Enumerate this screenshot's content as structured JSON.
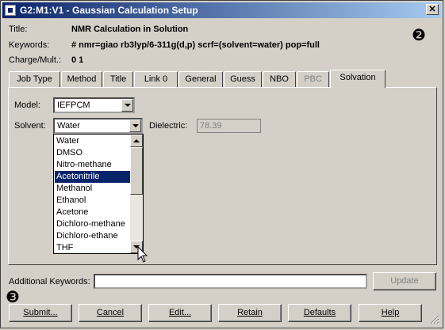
{
  "window": {
    "title": "G2:M1:V1 - Gaussian Calculation Setup",
    "close_glyph": "✕"
  },
  "header": {
    "title_label": "Title:",
    "title_value": "NMR Calculation in Solution",
    "keywords_label": "Keywords:",
    "keywords_value": "# nmr=giao rb3lyp/6-311g(d,p) scrf=(solvent=water) pop=full",
    "charge_label": "Charge/Mult.:",
    "charge_value": "0 1"
  },
  "badges": {
    "two": "❷",
    "three": "❸"
  },
  "tabs": [
    {
      "label": "Job Type",
      "state": "normal"
    },
    {
      "label": "Method",
      "state": "normal"
    },
    {
      "label": "Title",
      "state": "normal"
    },
    {
      "label": "Link 0",
      "state": "normal"
    },
    {
      "label": "General",
      "state": "normal"
    },
    {
      "label": "Guess",
      "state": "normal"
    },
    {
      "label": "NBO",
      "state": "normal"
    },
    {
      "label": "PBC",
      "state": "disabled"
    },
    {
      "label": "Solvation",
      "state": "active"
    }
  ],
  "solvation": {
    "model_label": "Model:",
    "model_value": "IEFPCM",
    "solvent_label": "Solvent:",
    "solvent_value": "Water",
    "dielectric_label": "Dielectric:",
    "dielectric_value": "78.39"
  },
  "solvent_list": {
    "items": [
      "Water",
      "DMSO",
      "Nitro-methane",
      "Acetonitrile",
      "Methanol",
      "Ethanol",
      "Acetone",
      "Dichloro-methane",
      "Dichloro-ethane",
      "THF"
    ],
    "selected": "Acetonitrile"
  },
  "additional": {
    "label": "Additional Keywords:",
    "value": "",
    "update_label": "Update"
  },
  "footer_buttons": [
    {
      "label": "Submit..."
    },
    {
      "label": "Cancel"
    },
    {
      "label": "Edit..."
    },
    {
      "label": "Retain"
    },
    {
      "label": "Defaults"
    },
    {
      "label": "Help"
    }
  ],
  "colors": {
    "titlebar_start": "#0a246a",
    "titlebar_end": "#a6caf0",
    "face": "#d4d0c8",
    "selection": "#0a246a"
  }
}
